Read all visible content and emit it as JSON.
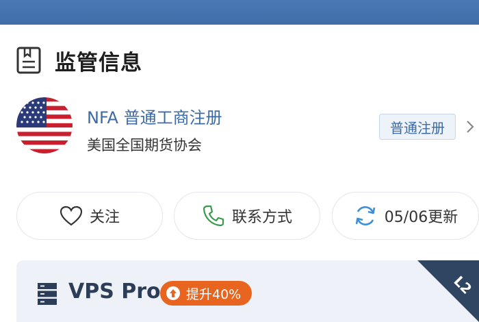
{
  "section": {
    "title": "监管信息",
    "icon": "document-icon"
  },
  "regulator": {
    "name": "NFA 普通工商注册",
    "description": "美国全国期货协会",
    "badge": "普通注册",
    "flag": "us-flag-icon",
    "accent_color": "#3b6aa6"
  },
  "actions": {
    "follow": {
      "label": "关注",
      "icon": "heart-icon"
    },
    "contact": {
      "label": "联系方式",
      "icon": "phone-icon"
    },
    "update": {
      "label": "05/06更新",
      "icon": "refresh-icon"
    }
  },
  "vps": {
    "title": "VPS Pro",
    "boost": "提升40%",
    "corner_label": "L2",
    "icon": "server-icon",
    "boost_color": "#e8651f"
  },
  "colors": {
    "top_bar": "#4472ad",
    "corner": "#2f4561"
  }
}
